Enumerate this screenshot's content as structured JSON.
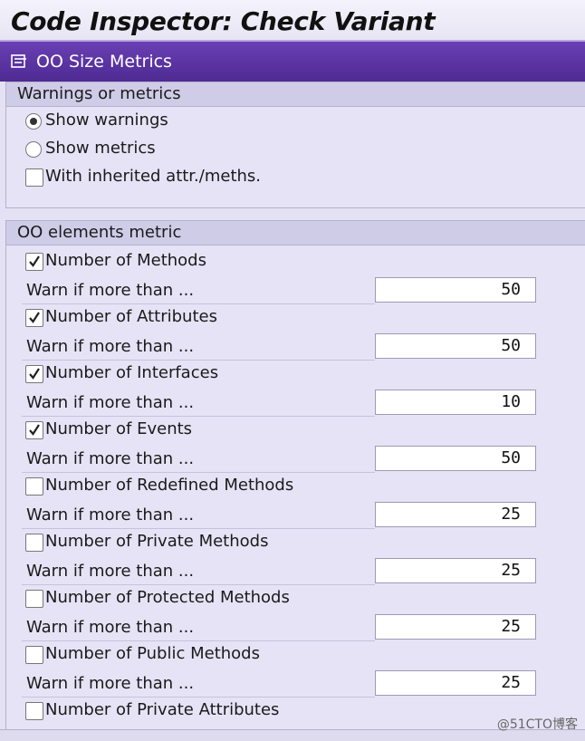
{
  "window": {
    "title": "Code Inspector: Check Variant"
  },
  "tab": {
    "label": "OO Size Metrics",
    "icon": "document-edit-icon"
  },
  "warnings_group": {
    "title": "Warnings or metrics",
    "options": [
      {
        "label": "Show warnings",
        "selected": true
      },
      {
        "label": "Show metrics",
        "selected": false
      }
    ],
    "inherited": {
      "label": "With inherited attr./meths.",
      "checked": false
    }
  },
  "elements_group": {
    "title": "OO elements metric",
    "warn_label": "Warn if more than ...",
    "items": [
      {
        "label": "Number of Methods",
        "checked": true,
        "threshold": "50"
      },
      {
        "label": "Number of Attributes",
        "checked": true,
        "threshold": "50"
      },
      {
        "label": "Number of Interfaces",
        "checked": true,
        "threshold": "10"
      },
      {
        "label": "Number of Events",
        "checked": true,
        "threshold": "50"
      },
      {
        "label": "Number of Redefined Methods",
        "checked": false,
        "threshold": "25"
      },
      {
        "label": "Number of Private Methods",
        "checked": false,
        "threshold": "25"
      },
      {
        "label": "Number of Protected Methods",
        "checked": false,
        "threshold": "25"
      },
      {
        "label": "Number of Public Methods",
        "checked": false,
        "threshold": "25"
      },
      {
        "label": "Number of Private Attributes",
        "checked": false
      }
    ]
  },
  "watermark": "@51CTO博客",
  "colors": {
    "tab_header": "#5a33a3",
    "group_title": "#cfcce8",
    "background": "#e4e1f5"
  }
}
